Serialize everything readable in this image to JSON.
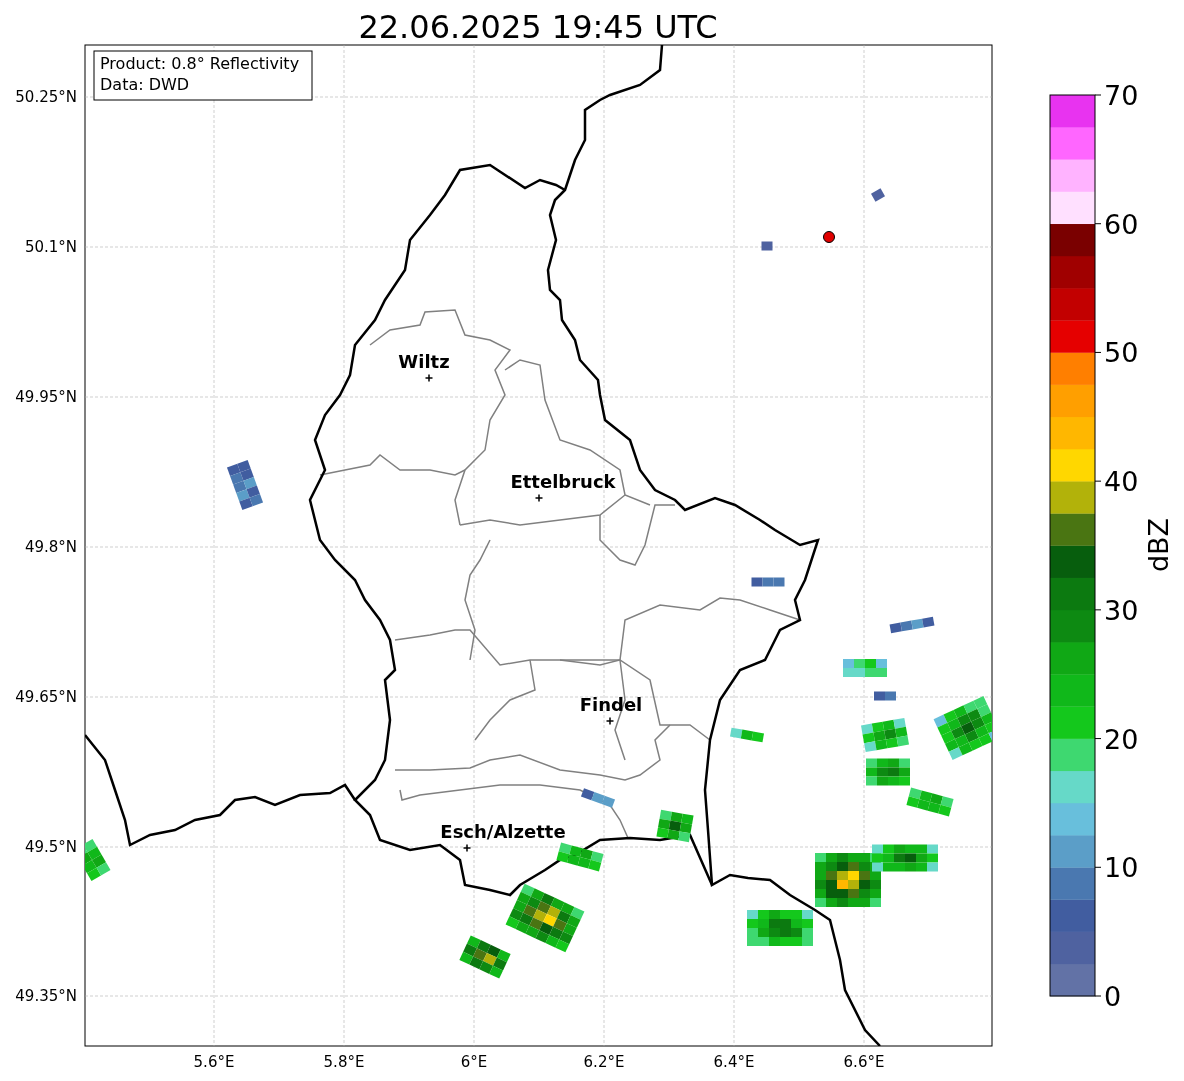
{
  "title": "22.06.2025 19:45 UTC",
  "info_box": {
    "lines": [
      "Product: 0.8° Reflectivity",
      "Data: DWD"
    ]
  },
  "cities": [
    {
      "name": "Wiltz"
    },
    {
      "name": "Ettelbruck"
    },
    {
      "name": "Findel"
    },
    {
      "name": "Esch/Alzette"
    }
  ],
  "lat_ticks": [
    "50.25°N",
    "50.1°N",
    "49.95°N",
    "49.8°N",
    "49.65°N",
    "49.5°N",
    "49.35°N"
  ],
  "lon_ticks": [
    "5.6°E",
    "5.8°E",
    "6°E",
    "6.2°E",
    "6.4°E",
    "6.6°E"
  ],
  "colorbar": {
    "label": "dBZ",
    "ticks": [
      "70",
      "60",
      "50",
      "40",
      "30",
      "20",
      "10",
      "0"
    ],
    "bins": [
      {
        "color": "#6272a6"
      },
      {
        "color": "#4f62a0"
      },
      {
        "color": "#415da0"
      },
      {
        "color": "#4a78b0"
      },
      {
        "color": "#5b9ec8"
      },
      {
        "color": "#68bfdc"
      },
      {
        "color": "#66d9c8"
      },
      {
        "color": "#3ed870"
      },
      {
        "color": "#14c81c"
      },
      {
        "color": "#10b81a"
      },
      {
        "color": "#10a815"
      },
      {
        "color": "#0d8a12"
      },
      {
        "color": "#0c7a10"
      },
      {
        "color": "#075e0d"
      },
      {
        "color": "#4a7512"
      },
      {
        "color": "#b2b20a"
      },
      {
        "color": "#ffd700"
      },
      {
        "color": "#ffb700"
      },
      {
        "color": "#ff9f00"
      },
      {
        "color": "#ff7f00"
      },
      {
        "color": "#e50000"
      },
      {
        "color": "#c20000"
      },
      {
        "color": "#a00000"
      },
      {
        "color": "#7a0000"
      },
      {
        "color": "#ffe0ff"
      },
      {
        "color": "#ffb3ff"
      },
      {
        "color": "#ff66ff"
      },
      {
        "color": "#e833f0"
      }
    ]
  }
}
